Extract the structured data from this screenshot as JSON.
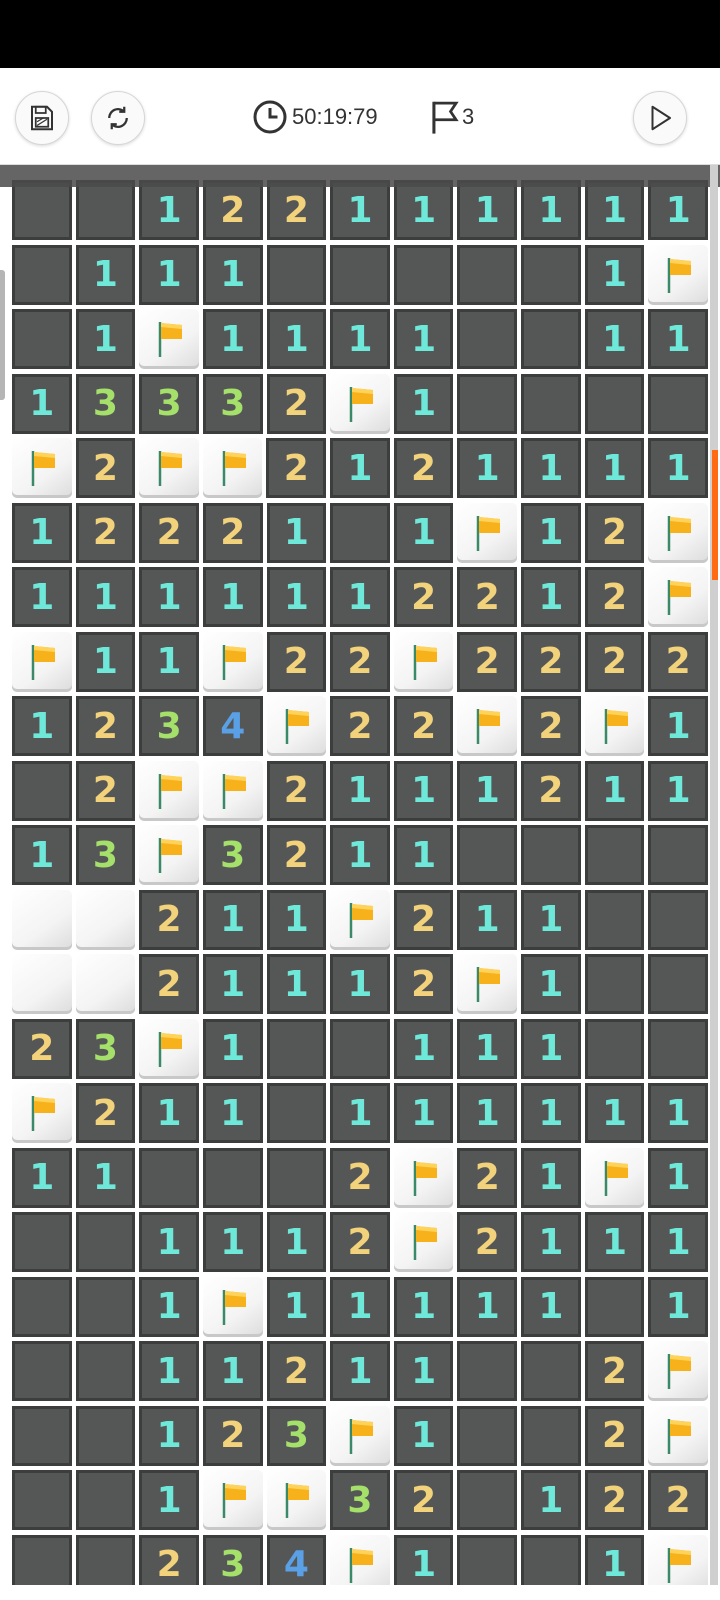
{
  "toolbar": {
    "timer": "50:19:79",
    "flag_count": "3",
    "save_icon": "save-icon",
    "restart_icon": "refresh-icon",
    "play_icon": "play-icon"
  },
  "colors": {
    "n1": "#6ee8d8",
    "n2": "#f2d27a",
    "n3": "#a4e06a",
    "n4": "#5aa0e6",
    "flag": "#f7b21b"
  },
  "board": {
    "legend": "R=revealed empty, F=flag, H=hidden, digits=revealed number",
    "rows": [
      "RR122111111",
      "R111RRRRR1F",
      "R1F1111RR11",
      "13332F1RRRR",
      "F2FF2121111",
      "12221R1F12F",
      "1111112212F",
      "F11F22F2222",
      "1234F22F2F1",
      "R2FF2111211",
      "13F3211RRRR",
      "HH211F211RR",
      "HH21112F1RR",
      "23F1RR111RR",
      "F211R111111",
      "11RRR2F21F1",
      "RR1112F2111",
      "RR1F11111R11",
      "RR11211RR2F",
      "RR123F1RR2F",
      "RR1FF32R122",
      "RR234F1RR1F1"
    ]
  }
}
